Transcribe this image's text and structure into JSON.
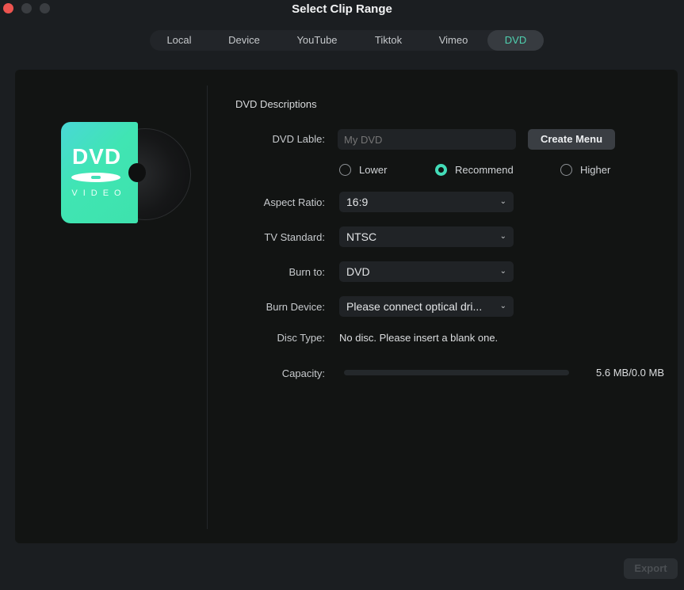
{
  "window": {
    "title": "Select Clip Range"
  },
  "tabs": [
    {
      "label": "Local",
      "active": false
    },
    {
      "label": "Device",
      "active": false
    },
    {
      "label": "YouTube",
      "active": false
    },
    {
      "label": "Tiktok",
      "active": false
    },
    {
      "label": "Vimeo",
      "active": false
    },
    {
      "label": "DVD",
      "active": true
    }
  ],
  "dvd_icon": {
    "title": "DVD",
    "subtitle": "VIDEO"
  },
  "form": {
    "section_title": "DVD Descriptions",
    "dvd_label": {
      "label": "DVD Lable:",
      "placeholder": "My DVD",
      "value": ""
    },
    "create_menu_label": "Create Menu",
    "quality": {
      "options": [
        "Lower",
        "Recommend",
        "Higher"
      ],
      "selected": "Recommend"
    },
    "aspect_ratio": {
      "label": "Aspect Ratio:",
      "value": "16:9"
    },
    "tv_standard": {
      "label": "TV Standard:",
      "value": "NTSC"
    },
    "burn_to": {
      "label": "Burn to:",
      "value": "DVD"
    },
    "burn_device": {
      "label": "Burn Device:",
      "value": "Please connect optical dri..."
    },
    "disc_type": {
      "label": "Disc Type:",
      "value": "No disc. Please insert a blank one."
    },
    "capacity": {
      "label": "Capacity:",
      "value": "5.6 MB/0.0 MB",
      "fill_percent": 0
    }
  },
  "footer": {
    "export_label": "Export",
    "export_enabled": false
  },
  "colors": {
    "accent": "#43dcb8",
    "close": "#ec5450"
  }
}
